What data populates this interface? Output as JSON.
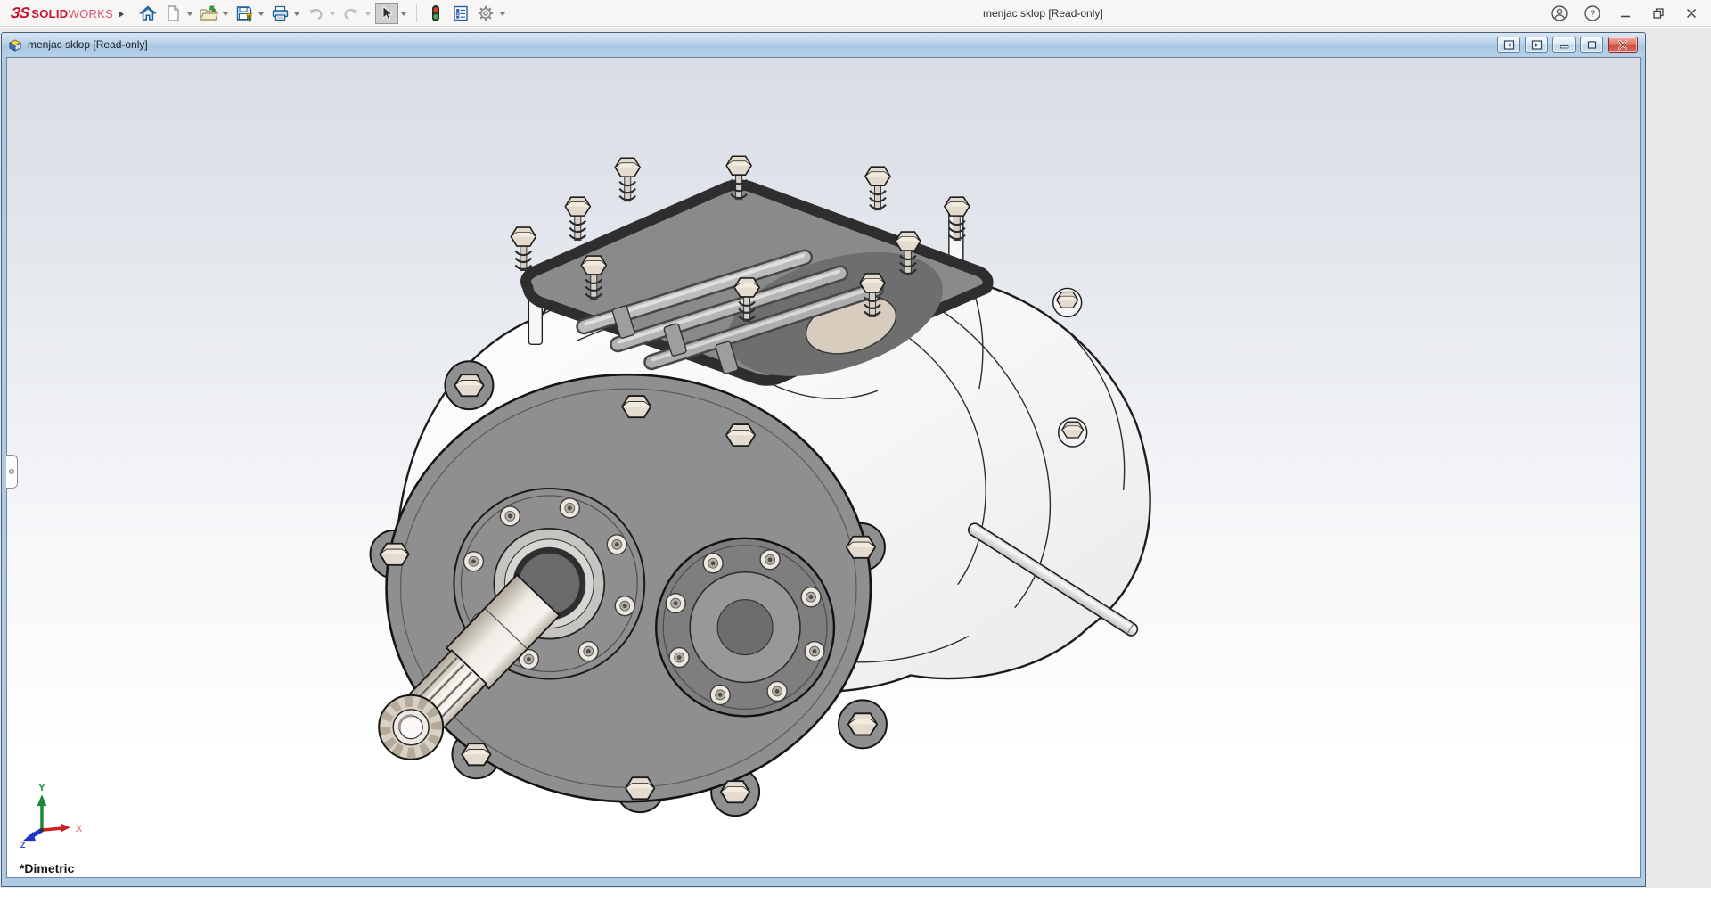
{
  "app": {
    "brand_mark": "ЗS",
    "brand_solid": "SOLID",
    "brand_works": "WORKS",
    "title": "menjac sklop [Read-only]"
  },
  "toolbar": {
    "icons": [
      "home",
      "new-document",
      "open",
      "save",
      "print",
      "undo",
      "redo",
      "select",
      "rebuild-traffic-light",
      "file-properties",
      "options-gear"
    ]
  },
  "titlebar_controls": [
    "account",
    "help",
    "minimize",
    "restore",
    "close"
  ],
  "glyphs": {
    "help": "?"
  },
  "document_window": {
    "title": "menjac sklop [Read-only]",
    "controls": [
      "collapse-left-pane",
      "collapse-right-pane",
      "minimize",
      "restore",
      "close"
    ]
  },
  "viewport": {
    "orientation_label": "*Dimetric",
    "triad_labels": {
      "x": "X",
      "y": "Y",
      "z": "Z"
    }
  },
  "colors": {
    "brand_red": "#c8102e",
    "child_titlebar_blue": "#b6d1e9",
    "mdi_gray": "#e8e8e8",
    "flange_gray": "#8f8f8f",
    "bolt_beige": "#e4dbce",
    "viewport_gradient_top": "#d8dce4"
  }
}
